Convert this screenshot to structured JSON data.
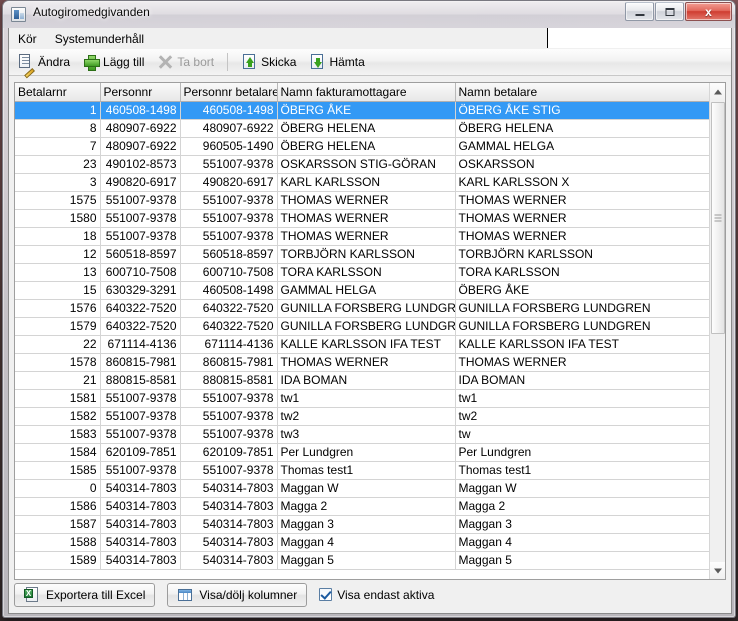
{
  "window": {
    "title": "Autogiromedgivanden",
    "icon": "app-icon",
    "caption_buttons": [
      {
        "name": "minimize",
        "label": "–"
      },
      {
        "name": "maximize",
        "label": "□"
      },
      {
        "name": "close",
        "label": "x"
      }
    ]
  },
  "menubar": {
    "items": [
      {
        "label": "Kör"
      },
      {
        "label": "Systemunderhåll"
      }
    ],
    "input_value": "",
    "input_placeholder": ""
  },
  "toolbar": {
    "buttons": [
      {
        "name": "edit",
        "label": "Ändra",
        "accel": "Ä",
        "icon": "edit-note-pencil-icon",
        "disabled": false
      },
      {
        "name": "add",
        "label": "Lägg till",
        "accel": "L",
        "icon": "green-plus-icon",
        "disabled": false
      },
      {
        "name": "delete",
        "label": "Ta bort",
        "accel": "T",
        "icon": "grey-x-icon",
        "disabled": true
      },
      {
        "name": "send",
        "label": "Skicka",
        "accel": "",
        "icon": "document-up-arrow-icon",
        "disabled": false
      },
      {
        "name": "fetch",
        "label": "Hämta",
        "accel": "",
        "icon": "document-down-arrow-icon",
        "disabled": false
      }
    ]
  },
  "grid": {
    "columns": [
      "Betalarnr",
      "Personnr",
      "Personnr betalare",
      "Namn fakturamottagare",
      "Namn betalare"
    ],
    "selected_row_index": 0,
    "selection_color": "#3399f5",
    "rows": [
      [
        "1",
        "460508-1498",
        "460508-1498",
        "ÖBERG ÅKE",
        "ÖBERG ÅKE STIG"
      ],
      [
        "8",
        "480907-6922",
        "480907-6922",
        "ÖBERG HELENA",
        "ÖBERG HELENA"
      ],
      [
        "7",
        "480907-6922",
        "960505-1490",
        "ÖBERG HELENA",
        "GAMMAL HELGA"
      ],
      [
        "23",
        "490102-8573",
        "551007-9378",
        "OSKARSSON STIG-GÖRAN",
        "OSKARSSON"
      ],
      [
        "3",
        "490820-6917",
        "490820-6917",
        "KARL KARLSSON",
        "KARL KARLSSON X"
      ],
      [
        "1575",
        "551007-9378",
        "551007-9378",
        "THOMAS WERNER",
        "THOMAS WERNER"
      ],
      [
        "1580",
        "551007-9378",
        "551007-9378",
        "THOMAS WERNER",
        "THOMAS WERNER"
      ],
      [
        "18",
        "551007-9378",
        "551007-9378",
        "THOMAS WERNER",
        "THOMAS WERNER"
      ],
      [
        "12",
        "560518-8597",
        "560518-8597",
        "TORBJÖRN KARLSSON",
        "TORBJÖRN KARLSSON"
      ],
      [
        "13",
        "600710-7508",
        "600710-7508",
        "TORA KARLSSON",
        "TORA KARLSSON"
      ],
      [
        "15",
        "630329-3291",
        "460508-1498",
        "GAMMAL HELGA",
        "ÖBERG ÅKE"
      ],
      [
        "1576",
        "640322-7520",
        "640322-7520",
        "GUNILLA FORSBERG LUNDGREN",
        "GUNILLA FORSBERG LUNDGREN"
      ],
      [
        "1579",
        "640322-7520",
        "640322-7520",
        "GUNILLA FORSBERG LUNDGREN",
        "GUNILLA FORSBERG LUNDGREN"
      ],
      [
        "22",
        "671114-4136",
        "671114-4136",
        "KALLE KARLSSON IFA TEST",
        "KALLE KARLSSON IFA TEST"
      ],
      [
        "1578",
        "860815-7981",
        "860815-7981",
        "THOMAS WERNER",
        "THOMAS WERNER"
      ],
      [
        "21",
        "880815-8581",
        "880815-8581",
        "IDA BOMAN",
        "IDA BOMAN"
      ],
      [
        "1581",
        "551007-9378",
        "551007-9378",
        "tw1",
        "tw1"
      ],
      [
        "1582",
        "551007-9378",
        "551007-9378",
        "tw2",
        "tw2"
      ],
      [
        "1583",
        "551007-9378",
        "551007-9378",
        "tw3",
        "tw"
      ],
      [
        "1584",
        "620109-7851",
        "620109-7851",
        "Per Lundgren",
        "Per Lundgren"
      ],
      [
        "1585",
        "551007-9378",
        "551007-9378",
        "Thomas test1",
        "Thomas test1"
      ],
      [
        "0",
        "540314-7803",
        "540314-7803",
        "Maggan W",
        "Maggan W"
      ],
      [
        "1586",
        "540314-7803",
        "540314-7803",
        "Magga 2",
        "Magga 2"
      ],
      [
        "1587",
        "540314-7803",
        "540314-7803",
        "Maggan 3",
        "Maggan 3"
      ],
      [
        "1588",
        "540314-7803",
        "540314-7803",
        "Maggan 4",
        "Maggan 4"
      ],
      [
        "1589",
        "540314-7803",
        "540314-7803",
        "Maggan 5",
        "Maggan 5"
      ]
    ]
  },
  "scrollbar": {
    "up_arrow": "▲",
    "down_arrow": "▼"
  },
  "bottombar": {
    "export_label": "Exportera till Excel",
    "export_icon": "excel-icon",
    "columns_label": "Visa/dölj kolumner",
    "columns_icon": "table-columns-icon",
    "checkbox_label": "Visa endast aktiva",
    "checkbox_checked": true
  }
}
